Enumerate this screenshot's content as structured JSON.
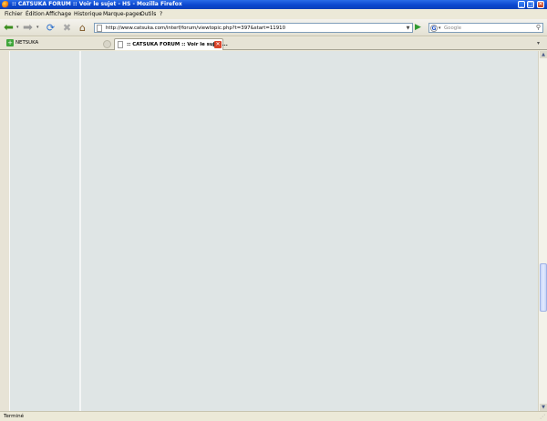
{
  "window": {
    "title": ":: CATSUKA FORUM :: Voir le sujet - HS - Mozilla Firefox",
    "buttons": {
      "minimize": "_",
      "maximize": "□",
      "close": "✕"
    }
  },
  "menu": [
    {
      "label": "Fichier"
    },
    {
      "label": "Édition"
    },
    {
      "label": "Affichage"
    },
    {
      "label": "Historique"
    },
    {
      "label": "Marque-pages"
    },
    {
      "label": "Outils"
    },
    {
      "label": "?"
    }
  ],
  "nav": {
    "url": "http://www.catsuka.com/interf/forum/viewtopic.php?t=397&start=11910",
    "search_placeholder": "Google",
    "search_engine_letter": "G"
  },
  "bookmarks": [
    {
      "label": "NETSUKA"
    }
  ],
  "tabs": [
    {
      "label": ":: CATSUKA FORUM :: Voir le sujet ..."
    }
  ],
  "status": {
    "text": "Terminé"
  },
  "colors": {
    "titlebar": "#0a47d0",
    "content_bg": "#dfe5e5",
    "chrome_bg": "#ece9d8"
  }
}
